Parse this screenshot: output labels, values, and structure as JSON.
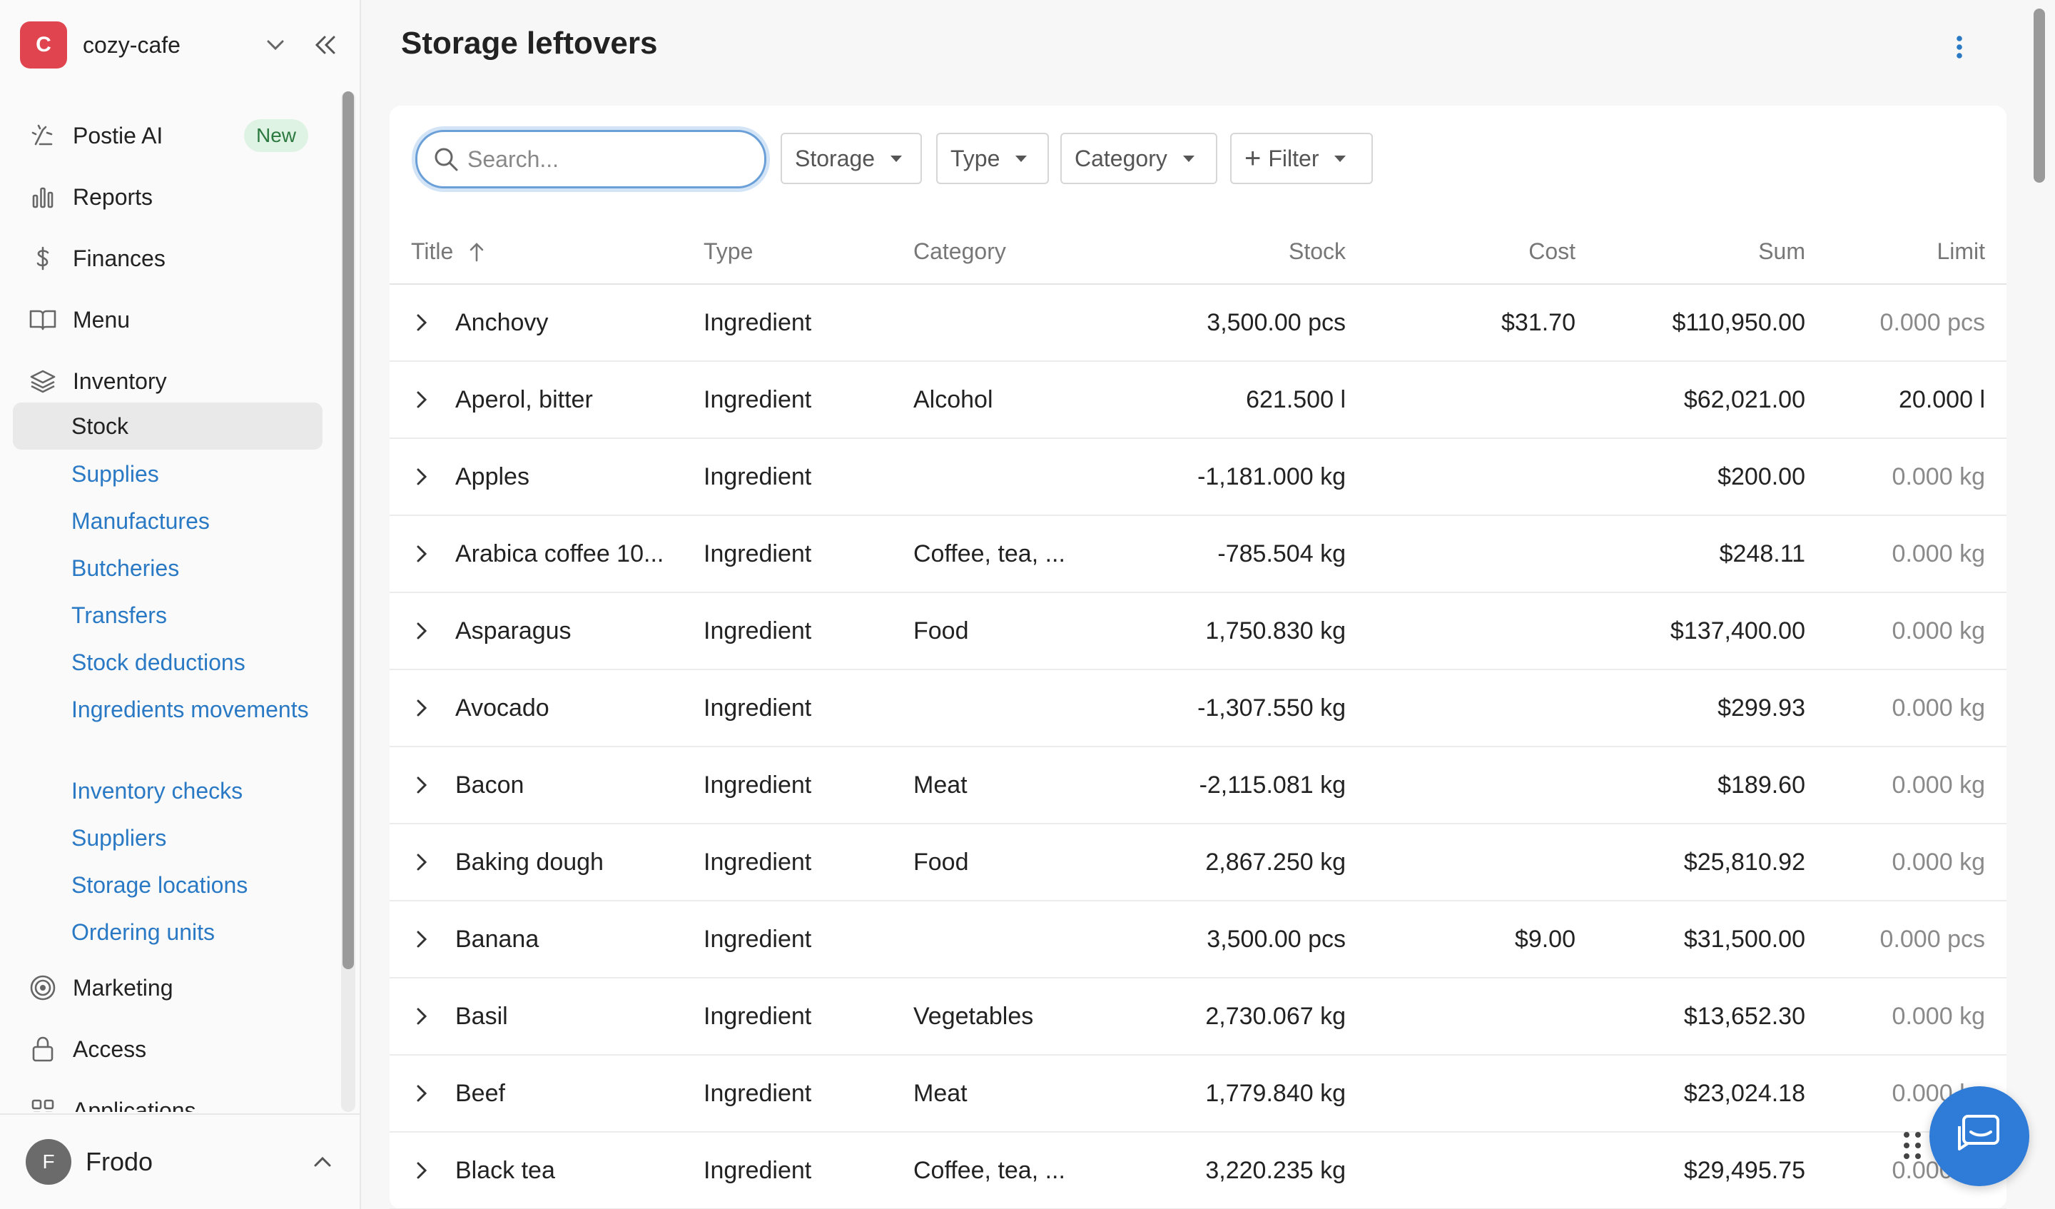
{
  "account": {
    "logo_letter": "C",
    "name": "cozy-cafe"
  },
  "nav": {
    "items": [
      {
        "label": "Postie AI",
        "icon": "wand-icon",
        "badge": "New"
      },
      {
        "label": "Reports",
        "icon": "bar-chart-icon"
      },
      {
        "label": "Finances",
        "icon": "dollar-icon"
      },
      {
        "label": "Menu",
        "icon": "book-icon"
      },
      {
        "label": "Inventory",
        "icon": "layers-icon"
      }
    ],
    "inventory_sub": {
      "active": "Stock",
      "items": [
        "Supplies",
        "Manufactures",
        "Butcheries",
        "Transfers",
        "Stock deductions",
        "Ingredients movements",
        "Inventory checks",
        "Suppliers",
        "Storage locations",
        "Ordering units"
      ]
    },
    "items_after": [
      {
        "label": "Marketing",
        "icon": "target-icon"
      },
      {
        "label": "Access",
        "icon": "lock-icon"
      },
      {
        "label": "Applications",
        "icon": "grid-icon"
      }
    ]
  },
  "user": {
    "initial": "F",
    "name": "Frodo"
  },
  "page": {
    "title": "Storage leftovers"
  },
  "search": {
    "placeholder": "Search...",
    "value": ""
  },
  "filters": {
    "storage": "Storage",
    "type": "Type",
    "category": "Category",
    "filter": "Filter"
  },
  "table": {
    "columns": [
      "Title",
      "Type",
      "Category",
      "Stock",
      "Cost",
      "Sum",
      "Limit"
    ],
    "rows": [
      {
        "title": "Anchovy",
        "type": "Ingredient",
        "category": "",
        "stock": "3,500.00 pcs",
        "cost": "$31.70",
        "sum": "$110,950.00",
        "limit": "0.000 pcs",
        "limit_muted": true
      },
      {
        "title": "Aperol, bitter",
        "type": "Ingredient",
        "category": "Alcohol",
        "stock": "621.500 l",
        "cost": "",
        "sum": "$62,021.00",
        "limit": "20.000 l",
        "limit_muted": false
      },
      {
        "title": "Apples",
        "type": "Ingredient",
        "category": "",
        "stock": "-1,181.000 kg",
        "cost": "",
        "sum": "$200.00",
        "limit": "0.000 kg",
        "limit_muted": true
      },
      {
        "title": "Arabica coffee 10...",
        "type": "Ingredient",
        "category": "Coffee, tea, ...",
        "stock": "-785.504 kg",
        "cost": "",
        "sum": "$248.11",
        "limit": "0.000 kg",
        "limit_muted": true
      },
      {
        "title": "Asparagus",
        "type": "Ingredient",
        "category": "Food",
        "stock": "1,750.830 kg",
        "cost": "",
        "sum": "$137,400.00",
        "limit": "0.000 kg",
        "limit_muted": true
      },
      {
        "title": "Avocado",
        "type": "Ingredient",
        "category": "",
        "stock": "-1,307.550 kg",
        "cost": "",
        "sum": "$299.93",
        "limit": "0.000 kg",
        "limit_muted": true
      },
      {
        "title": "Bacon",
        "type": "Ingredient",
        "category": "Meat",
        "stock": "-2,115.081 kg",
        "cost": "",
        "sum": "$189.60",
        "limit": "0.000 kg",
        "limit_muted": true
      },
      {
        "title": "Baking dough",
        "type": "Ingredient",
        "category": "Food",
        "stock": "2,867.250 kg",
        "cost": "",
        "sum": "$25,810.92",
        "limit": "0.000 kg",
        "limit_muted": true
      },
      {
        "title": "Banana",
        "type": "Ingredient",
        "category": "",
        "stock": "3,500.00 pcs",
        "cost": "$9.00",
        "sum": "$31,500.00",
        "limit": "0.000 pcs",
        "limit_muted": true
      },
      {
        "title": "Basil",
        "type": "Ingredient",
        "category": "Vegetables",
        "stock": "2,730.067 kg",
        "cost": "",
        "sum": "$13,652.30",
        "limit": "0.000 kg",
        "limit_muted": true
      },
      {
        "title": "Beef",
        "type": "Ingredient",
        "category": "Meat",
        "stock": "1,779.840 kg",
        "cost": "",
        "sum": "$23,024.18",
        "limit": "0.000 kg",
        "limit_muted": true
      },
      {
        "title": "Black tea",
        "type": "Ingredient",
        "category": "Coffee, tea, ...",
        "stock": "3,220.235 kg",
        "cost": "",
        "sum": "$29,495.75",
        "limit": "0.000 kg",
        "limit_muted": true
      }
    ]
  },
  "colors": {
    "accent": "#2a79c4",
    "brand": "#e0454f",
    "chat": "#2f7bd8"
  }
}
